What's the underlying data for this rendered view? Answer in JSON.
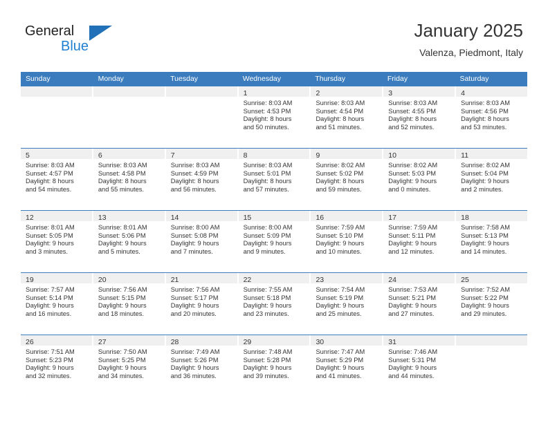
{
  "brand": {
    "name_part1": "General",
    "name_part2": "Blue",
    "accent_color": "#2170b8"
  },
  "header": {
    "title": "January 2025",
    "location": "Valenza, Piedmont, Italy"
  },
  "colors": {
    "header_blue": "#3a7cbe",
    "daynum_band": "#f0f0f0",
    "text": "#333333"
  },
  "weekdays": [
    "Sunday",
    "Monday",
    "Tuesday",
    "Wednesday",
    "Thursday",
    "Friday",
    "Saturday"
  ],
  "weeks": [
    [
      {
        "day": "",
        "lines": []
      },
      {
        "day": "",
        "lines": []
      },
      {
        "day": "",
        "lines": []
      },
      {
        "day": "1",
        "lines": [
          "Sunrise: 8:03 AM",
          "Sunset: 4:53 PM",
          "Daylight: 8 hours",
          "and 50 minutes."
        ]
      },
      {
        "day": "2",
        "lines": [
          "Sunrise: 8:03 AM",
          "Sunset: 4:54 PM",
          "Daylight: 8 hours",
          "and 51 minutes."
        ]
      },
      {
        "day": "3",
        "lines": [
          "Sunrise: 8:03 AM",
          "Sunset: 4:55 PM",
          "Daylight: 8 hours",
          "and 52 minutes."
        ]
      },
      {
        "day": "4",
        "lines": [
          "Sunrise: 8:03 AM",
          "Sunset: 4:56 PM",
          "Daylight: 8 hours",
          "and 53 minutes."
        ]
      }
    ],
    [
      {
        "day": "5",
        "lines": [
          "Sunrise: 8:03 AM",
          "Sunset: 4:57 PM",
          "Daylight: 8 hours",
          "and 54 minutes."
        ]
      },
      {
        "day": "6",
        "lines": [
          "Sunrise: 8:03 AM",
          "Sunset: 4:58 PM",
          "Daylight: 8 hours",
          "and 55 minutes."
        ]
      },
      {
        "day": "7",
        "lines": [
          "Sunrise: 8:03 AM",
          "Sunset: 4:59 PM",
          "Daylight: 8 hours",
          "and 56 minutes."
        ]
      },
      {
        "day": "8",
        "lines": [
          "Sunrise: 8:03 AM",
          "Sunset: 5:01 PM",
          "Daylight: 8 hours",
          "and 57 minutes."
        ]
      },
      {
        "day": "9",
        "lines": [
          "Sunrise: 8:02 AM",
          "Sunset: 5:02 PM",
          "Daylight: 8 hours",
          "and 59 minutes."
        ]
      },
      {
        "day": "10",
        "lines": [
          "Sunrise: 8:02 AM",
          "Sunset: 5:03 PM",
          "Daylight: 9 hours",
          "and 0 minutes."
        ]
      },
      {
        "day": "11",
        "lines": [
          "Sunrise: 8:02 AM",
          "Sunset: 5:04 PM",
          "Daylight: 9 hours",
          "and 2 minutes."
        ]
      }
    ],
    [
      {
        "day": "12",
        "lines": [
          "Sunrise: 8:01 AM",
          "Sunset: 5:05 PM",
          "Daylight: 9 hours",
          "and 3 minutes."
        ]
      },
      {
        "day": "13",
        "lines": [
          "Sunrise: 8:01 AM",
          "Sunset: 5:06 PM",
          "Daylight: 9 hours",
          "and 5 minutes."
        ]
      },
      {
        "day": "14",
        "lines": [
          "Sunrise: 8:00 AM",
          "Sunset: 5:08 PM",
          "Daylight: 9 hours",
          "and 7 minutes."
        ]
      },
      {
        "day": "15",
        "lines": [
          "Sunrise: 8:00 AM",
          "Sunset: 5:09 PM",
          "Daylight: 9 hours",
          "and 9 minutes."
        ]
      },
      {
        "day": "16",
        "lines": [
          "Sunrise: 7:59 AM",
          "Sunset: 5:10 PM",
          "Daylight: 9 hours",
          "and 10 minutes."
        ]
      },
      {
        "day": "17",
        "lines": [
          "Sunrise: 7:59 AM",
          "Sunset: 5:11 PM",
          "Daylight: 9 hours",
          "and 12 minutes."
        ]
      },
      {
        "day": "18",
        "lines": [
          "Sunrise: 7:58 AM",
          "Sunset: 5:13 PM",
          "Daylight: 9 hours",
          "and 14 minutes."
        ]
      }
    ],
    [
      {
        "day": "19",
        "lines": [
          "Sunrise: 7:57 AM",
          "Sunset: 5:14 PM",
          "Daylight: 9 hours",
          "and 16 minutes."
        ]
      },
      {
        "day": "20",
        "lines": [
          "Sunrise: 7:56 AM",
          "Sunset: 5:15 PM",
          "Daylight: 9 hours",
          "and 18 minutes."
        ]
      },
      {
        "day": "21",
        "lines": [
          "Sunrise: 7:56 AM",
          "Sunset: 5:17 PM",
          "Daylight: 9 hours",
          "and 20 minutes."
        ]
      },
      {
        "day": "22",
        "lines": [
          "Sunrise: 7:55 AM",
          "Sunset: 5:18 PM",
          "Daylight: 9 hours",
          "and 23 minutes."
        ]
      },
      {
        "day": "23",
        "lines": [
          "Sunrise: 7:54 AM",
          "Sunset: 5:19 PM",
          "Daylight: 9 hours",
          "and 25 minutes."
        ]
      },
      {
        "day": "24",
        "lines": [
          "Sunrise: 7:53 AM",
          "Sunset: 5:21 PM",
          "Daylight: 9 hours",
          "and 27 minutes."
        ]
      },
      {
        "day": "25",
        "lines": [
          "Sunrise: 7:52 AM",
          "Sunset: 5:22 PM",
          "Daylight: 9 hours",
          "and 29 minutes."
        ]
      }
    ],
    [
      {
        "day": "26",
        "lines": [
          "Sunrise: 7:51 AM",
          "Sunset: 5:23 PM",
          "Daylight: 9 hours",
          "and 32 minutes."
        ]
      },
      {
        "day": "27",
        "lines": [
          "Sunrise: 7:50 AM",
          "Sunset: 5:25 PM",
          "Daylight: 9 hours",
          "and 34 minutes."
        ]
      },
      {
        "day": "28",
        "lines": [
          "Sunrise: 7:49 AM",
          "Sunset: 5:26 PM",
          "Daylight: 9 hours",
          "and 36 minutes."
        ]
      },
      {
        "day": "29",
        "lines": [
          "Sunrise: 7:48 AM",
          "Sunset: 5:28 PM",
          "Daylight: 9 hours",
          "and 39 minutes."
        ]
      },
      {
        "day": "30",
        "lines": [
          "Sunrise: 7:47 AM",
          "Sunset: 5:29 PM",
          "Daylight: 9 hours",
          "and 41 minutes."
        ]
      },
      {
        "day": "31",
        "lines": [
          "Sunrise: 7:46 AM",
          "Sunset: 5:31 PM",
          "Daylight: 9 hours",
          "and 44 minutes."
        ]
      },
      {
        "day": "",
        "lines": []
      }
    ]
  ]
}
